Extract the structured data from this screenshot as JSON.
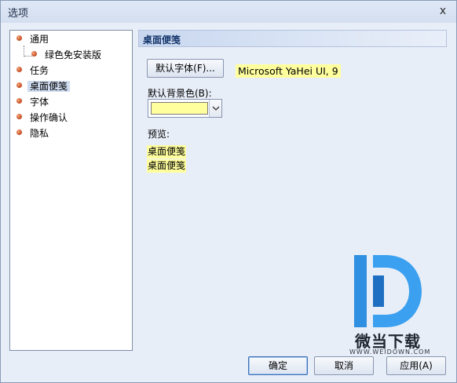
{
  "window": {
    "title": "选项",
    "close_glyph": "x"
  },
  "tree": {
    "items": [
      {
        "label": "通用"
      },
      {
        "label": "绿色免安装版"
      },
      {
        "label": "任务"
      },
      {
        "label": "桌面便笺"
      },
      {
        "label": "字体"
      },
      {
        "label": "操作确认"
      },
      {
        "label": "隐私"
      }
    ],
    "selected": "桌面便笺"
  },
  "panel": {
    "header": "桌面便笺",
    "font_button_label": "默认字体(F)...",
    "font_sample": "Microsoft YaHei UI, 9",
    "bg_color_label": "默认背景色(B):",
    "bg_color_value": "#ffff9e",
    "preview_label": "预览:",
    "preview_lines": [
      "桌面便笺",
      "桌面便笺"
    ]
  },
  "footer": {
    "ok_label": "确定",
    "cancel_label": "取消",
    "apply_label": "应用(A)"
  },
  "watermark": {
    "text_cn": "微当下载",
    "text_en": "WWW.WEIDOWN.COM"
  },
  "colors": {
    "accent": "#15366b",
    "highlight": "#ffff9e",
    "bullet": "#c2461f",
    "watermark_blue": "#2f8fe0"
  }
}
